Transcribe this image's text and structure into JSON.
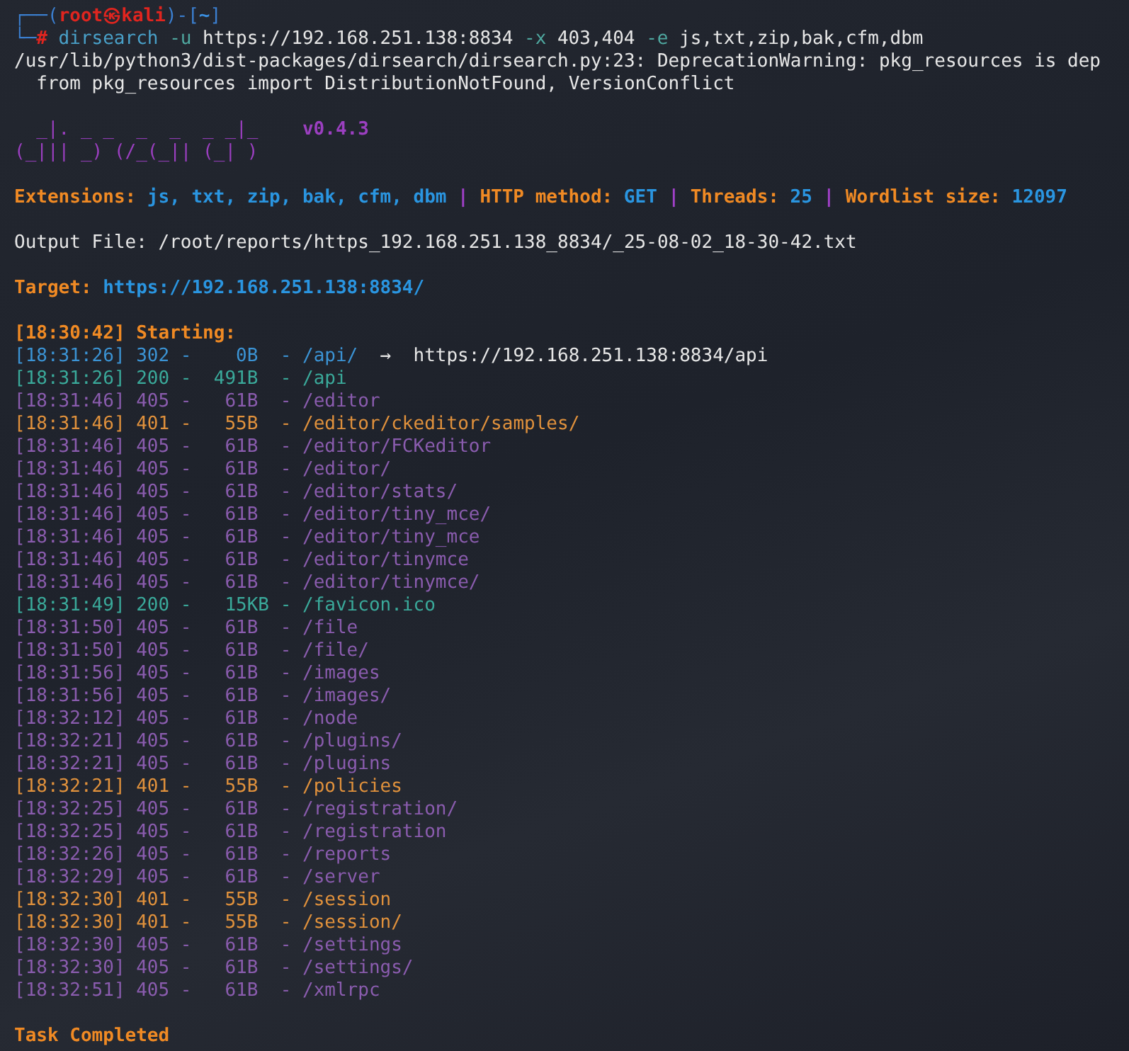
{
  "prompt": [
    {
      "kind": "frame",
      "text": "┌──("
    },
    {
      "kind": "user",
      "text": "root㉿kali"
    },
    {
      "kind": "frame",
      "text": ")-["
    },
    {
      "kind": "dir",
      "text": "~"
    },
    {
      "kind": "frame",
      "text": "]"
    }
  ],
  "command": [
    {
      "kind": "frame",
      "text": "└─"
    },
    {
      "kind": "hash",
      "text": "#"
    },
    {
      "kind": "program",
      "text": "dirsearch"
    },
    {
      "kind": "flag",
      "text": "-u"
    },
    {
      "kind": "arg",
      "text": "https://192.168.251.138:8834"
    },
    {
      "kind": "flag",
      "text": "-x"
    },
    {
      "kind": "arg",
      "text": "403,404"
    },
    {
      "kind": "flag",
      "text": "-e"
    },
    {
      "kind": "arg",
      "text": "js,txt,zip,bak,cfm,dbm"
    }
  ],
  "warning": [
    "/usr/lib/python3/dist-packages/dirsearch/dirsearch.py:23: DeprecationWarning: pkg_resources is dep",
    "  from pkg_resources import DistributionNotFound, VersionConflict"
  ],
  "banner": {
    "art": [
      "  _|. _ _  _  _  _ _|_",
      "(_||| _) (/_(_|| (_| )"
    ],
    "version": "v0.4.3"
  },
  "summary": [
    {
      "kind": "label",
      "text": "Extensions:"
    },
    {
      "kind": "value",
      "text": "js, txt, zip, bak, cfm, dbm"
    },
    {
      "kind": "sep",
      "text": "|"
    },
    {
      "kind": "label",
      "text": "HTTP method:"
    },
    {
      "kind": "value",
      "text": "GET"
    },
    {
      "kind": "sep",
      "text": "|"
    },
    {
      "kind": "label",
      "text": "Threads:"
    },
    {
      "kind": "value",
      "text": "25"
    },
    {
      "kind": "sep",
      "text": "|"
    },
    {
      "kind": "label",
      "text": "Wordlist size:"
    },
    {
      "kind": "value",
      "text": "12097"
    }
  ],
  "output_file": "Output File: /root/reports/https_192.168.251.138_8834/_25-08-02_18-30-42.txt",
  "target": {
    "label": "Target:",
    "url": "https://192.168.251.138:8834/"
  },
  "start": "[18:30:42] Starting:",
  "rows": [
    {
      "line": "[18:31:26] 302 -    0B  - /api/",
      "color": "#3b93d4",
      "redirect": {
        "arrow": "→",
        "url": "https://192.168.251.138:8834/api"
      }
    },
    {
      "line": "[18:31:26] 200 -  491B  - /api",
      "color": "#3aa99a"
    },
    {
      "line": "[18:31:46] 405 -   61B  - /editor",
      "color": "#8a5cae"
    },
    {
      "line": "[18:31:46] 401 -   55B  - /editor/ckeditor/samples/",
      "color": "#e0913c"
    },
    {
      "line": "[18:31:46] 405 -   61B  - /editor/FCKeditor",
      "color": "#8a5cae"
    },
    {
      "line": "[18:31:46] 405 -   61B  - /editor/",
      "color": "#8a5cae"
    },
    {
      "line": "[18:31:46] 405 -   61B  - /editor/stats/",
      "color": "#8a5cae"
    },
    {
      "line": "[18:31:46] 405 -   61B  - /editor/tiny_mce/",
      "color": "#8a5cae"
    },
    {
      "line": "[18:31:46] 405 -   61B  - /editor/tiny_mce",
      "color": "#8a5cae"
    },
    {
      "line": "[18:31:46] 405 -   61B  - /editor/tinymce",
      "color": "#8a5cae"
    },
    {
      "line": "[18:31:46] 405 -   61B  - /editor/tinymce/",
      "color": "#8a5cae"
    },
    {
      "line": "[18:31:49] 200 -   15KB - /favicon.ico",
      "color": "#3aa99a"
    },
    {
      "line": "[18:31:50] 405 -   61B  - /file",
      "color": "#8a5cae"
    },
    {
      "line": "[18:31:50] 405 -   61B  - /file/",
      "color": "#8a5cae"
    },
    {
      "line": "[18:31:56] 405 -   61B  - /images",
      "color": "#8a5cae"
    },
    {
      "line": "[18:31:56] 405 -   61B  - /images/",
      "color": "#8a5cae"
    },
    {
      "line": "[18:32:12] 405 -   61B  - /node",
      "color": "#8a5cae"
    },
    {
      "line": "[18:32:21] 405 -   61B  - /plugins/",
      "color": "#8a5cae"
    },
    {
      "line": "[18:32:21] 405 -   61B  - /plugins",
      "color": "#8a5cae"
    },
    {
      "line": "[18:32:21] 401 -   55B  - /policies",
      "color": "#e0913c"
    },
    {
      "line": "[18:32:25] 405 -   61B  - /registration/",
      "color": "#8a5cae"
    },
    {
      "line": "[18:32:25] 405 -   61B  - /registration",
      "color": "#8a5cae"
    },
    {
      "line": "[18:32:26] 405 -   61B  - /reports",
      "color": "#8a5cae"
    },
    {
      "line": "[18:32:29] 405 -   61B  - /server",
      "color": "#8a5cae"
    },
    {
      "line": "[18:32:30] 401 -   55B  - /session",
      "color": "#e0913c"
    },
    {
      "line": "[18:32:30] 401 -   55B  - /session/",
      "color": "#e0913c"
    },
    {
      "line": "[18:32:30] 405 -   61B  - /settings",
      "color": "#8a5cae"
    },
    {
      "line": "[18:32:30] 405 -   61B  - /settings/",
      "color": "#8a5cae"
    },
    {
      "line": "[18:32:51] 405 -   61B  - /xmlrpc",
      "color": "#8a5cae"
    }
  ],
  "done": "Task Completed"
}
